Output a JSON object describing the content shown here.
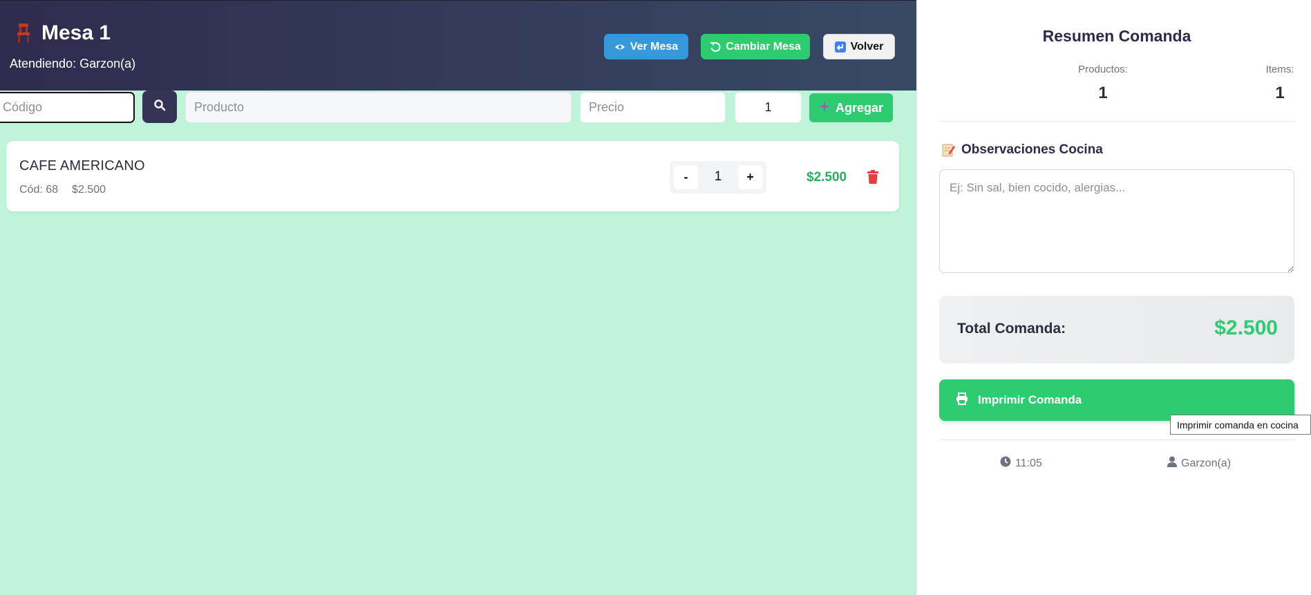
{
  "header": {
    "title": "Mesa 1",
    "subtitle": "Atendiendo: Garzon(a)",
    "buttons": {
      "ver_mesa": "Ver Mesa",
      "cambiar_mesa": "Cambiar Mesa",
      "volver": "Volver"
    }
  },
  "search": {
    "codigo_placeholder": "Código",
    "producto_placeholder": "Producto",
    "precio_placeholder": "Precio",
    "cantidad_value": "1",
    "agregar_label": "Agregar"
  },
  "items": [
    {
      "name": "CAFE AMERICANO",
      "code": "Cód: 68",
      "unit_price": "$2.500",
      "quantity": "1",
      "minus": "-",
      "plus": "+",
      "total": "$2.500"
    }
  ],
  "summary": {
    "title": "Resumen Comanda",
    "productos_label": "Productos:",
    "productos_value": "1",
    "items_label": "Items:",
    "items_value": "1",
    "observaciones_title": "Observaciones Cocina",
    "observaciones_placeholder": "Ej: Sin sal, bien cocido, alergias...",
    "total_label": "Total Comanda:",
    "total_value": "$2.500",
    "print_label": "Imprimir Comanda",
    "time": "11:05",
    "user": "Garzon(a)"
  },
  "tooltip": "Imprimir comanda en cocina",
  "colors": {
    "header_start": "#2f2c4e",
    "header_end": "#384964",
    "main_bg": "#c0f4da",
    "accent_green": "#2ecc71",
    "accent_blue": "#3498db",
    "delete_red": "#e53e3e"
  },
  "icons": {
    "title": "chair-icon",
    "ver_mesa": "eye-icon",
    "cambiar_mesa": "undo-icon",
    "volver": "return-icon",
    "search": "search-icon",
    "agregar": "sparkle-plus-icon",
    "delete": "trash-icon",
    "observaciones": "memo-icon",
    "print": "printer-icon",
    "time": "clock-icon",
    "user": "user-icon"
  }
}
